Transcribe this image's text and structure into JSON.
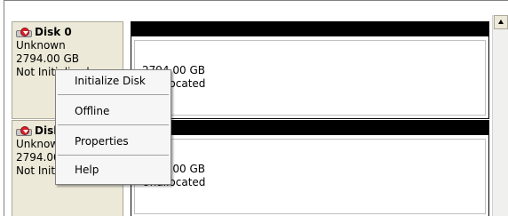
{
  "disks": [
    {
      "name": "Disk 0",
      "type": "Unknown",
      "size": "2794.00 GB",
      "status": "Not Initialized",
      "partition_size": "2794.00 GB",
      "partition_state": "Unallocated"
    },
    {
      "name": "Disk 1",
      "type": "Unknown",
      "size": "2794.00 GB",
      "status": "Not Initialized",
      "partition_size": "2794.00 GB",
      "partition_state": "Unallocated"
    }
  ],
  "context_menu": {
    "items": [
      "Initialize Disk",
      "Offline",
      "Properties",
      "Help"
    ]
  },
  "icons": {
    "disk": "unknown-disk-icon",
    "scroll_up": "scroll-up-arrow-icon"
  },
  "colors": {
    "partition_bar": "#000000",
    "menu_bg": "#f6f6f6",
    "label_bg": "#ece9d8"
  }
}
